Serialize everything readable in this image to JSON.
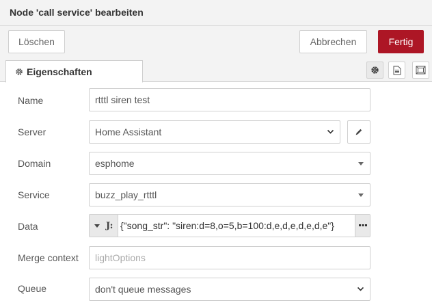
{
  "dialog": {
    "title": "Node 'call service' bearbeiten"
  },
  "buttons": {
    "delete": "Löschen",
    "cancel": "Abbrechen",
    "done": "Fertig"
  },
  "tabs": {
    "properties": "Eigenschaften"
  },
  "colors": {
    "accent": "#ad1625",
    "panel": "#f3f3f3",
    "border": "#cfcfcf"
  },
  "form": {
    "name": {
      "label": "Name",
      "value": "rtttl siren test"
    },
    "server": {
      "label": "Server",
      "value": "Home Assistant"
    },
    "domain": {
      "label": "Domain",
      "value": "esphome"
    },
    "service": {
      "label": "Service",
      "value": "buzz_play_rtttl"
    },
    "data": {
      "label": "Data",
      "type_icon": "J:",
      "value": "{\"song_str\": \"siren:d=8,o=5,b=100:d,e,d,e,d,e,d,e\"}"
    },
    "merge_context": {
      "label": "Merge context",
      "placeholder": "lightOptions"
    },
    "queue": {
      "label": "Queue",
      "value": "don't queue messages"
    }
  }
}
